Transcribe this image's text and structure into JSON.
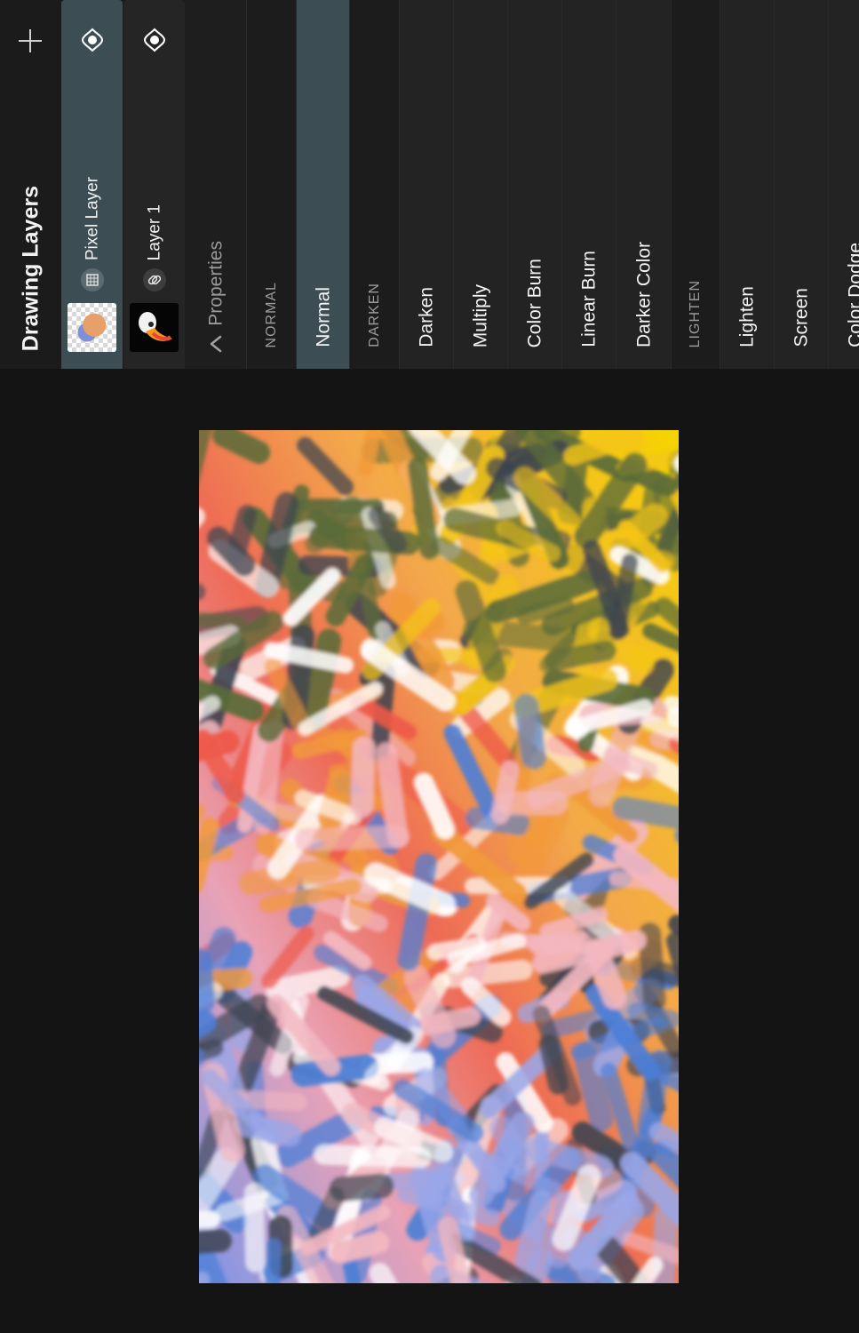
{
  "panel": {
    "title": "Drawing Layers",
    "add_icon": "plus-icon",
    "layers": [
      {
        "name": "Pixel Layer",
        "visibility_icon": "eye-visible-icon",
        "type_icon": "pixel-grid-icon",
        "selected": true
      },
      {
        "name": "Layer 1",
        "visibility_icon": "eye-visible-icon",
        "type_icon": "link-icon",
        "selected": false
      }
    ],
    "properties_label": "Properties",
    "properties_icon": "chevron-down-icon",
    "blend_modes": [
      {
        "label": "NORMAL",
        "kind": "section"
      },
      {
        "label": "Normal",
        "kind": "item",
        "active": true
      },
      {
        "label": "DARKEN",
        "kind": "section"
      },
      {
        "label": "Darken",
        "kind": "item"
      },
      {
        "label": "Multiply",
        "kind": "item"
      },
      {
        "label": "Color Burn",
        "kind": "item"
      },
      {
        "label": "Linear Burn",
        "kind": "item"
      },
      {
        "label": "Darker Color",
        "kind": "item"
      },
      {
        "label": "LIGHTEN",
        "kind": "section"
      },
      {
        "label": "Lighten",
        "kind": "item"
      },
      {
        "label": "Screen",
        "kind": "item"
      },
      {
        "label": "Color Dodge",
        "kind": "item"
      }
    ]
  },
  "colors": {
    "background": "#141414",
    "panel": "#1a1a1a",
    "selected": "#3c4e54",
    "section_text": "#9b9b9b"
  },
  "canvas": {
    "palette": [
      "#f5c518",
      "#f29a3a",
      "#ee5a4a",
      "#f3b8c0",
      "#9aa7e8",
      "#4d7fd6",
      "#5a6b3a",
      "#3d4450",
      "#ffffff"
    ]
  }
}
